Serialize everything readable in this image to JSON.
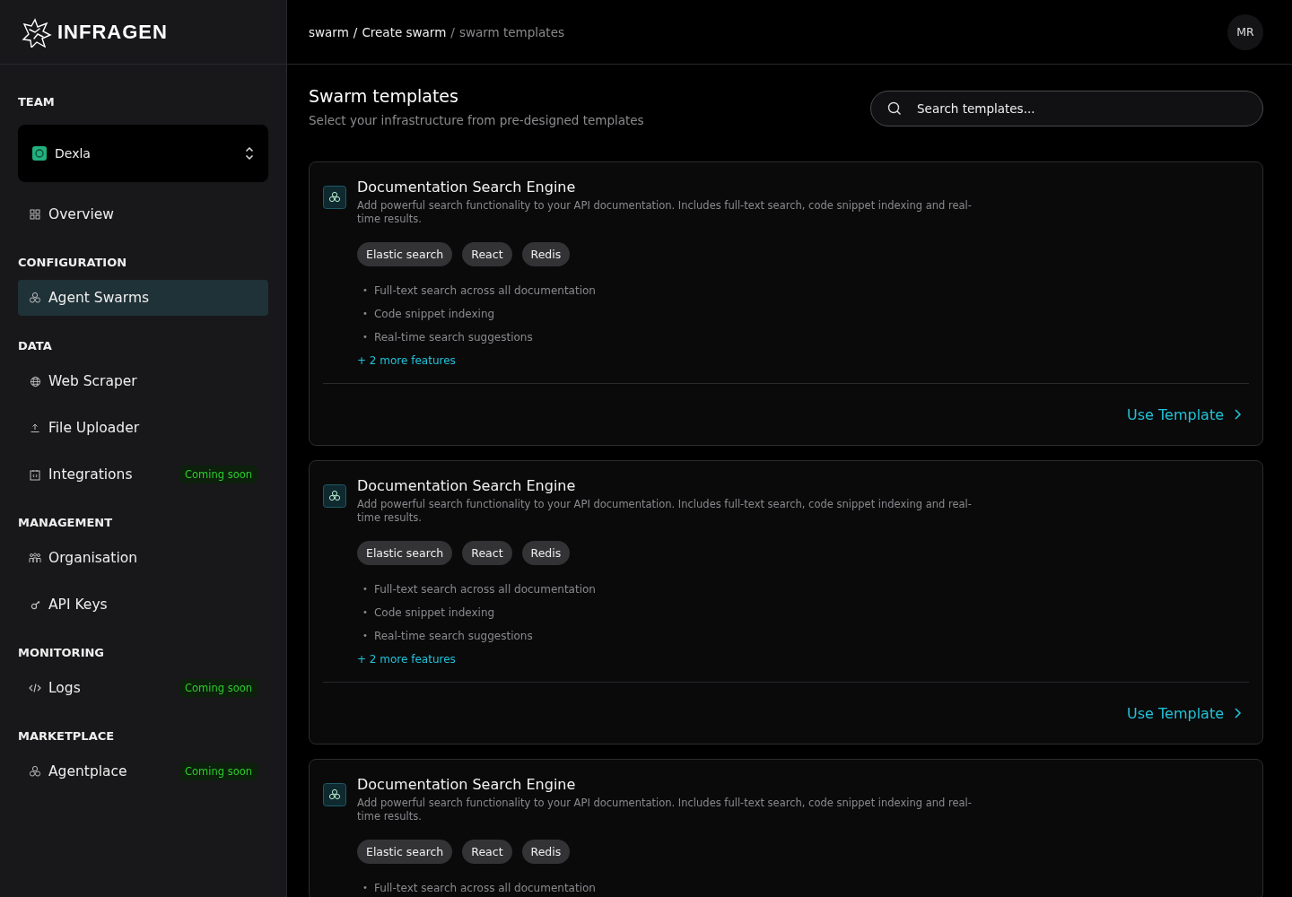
{
  "brand": {
    "name": "INFRAGEN"
  },
  "sidebar": {
    "sections": [
      {
        "label": "TEAM",
        "team_selector": {
          "name": "Dexla"
        },
        "items": [
          {
            "label": "Overview",
            "selected": false
          }
        ]
      },
      {
        "label": "CONFIGURATION",
        "items": [
          {
            "label": "Agent Swarms",
            "selected": true
          }
        ]
      },
      {
        "label": "DATA",
        "items": [
          {
            "label": "Web Scraper",
            "selected": false
          },
          {
            "label": "File Uploader",
            "selected": false
          },
          {
            "label": "Integrations",
            "selected": false,
            "badge": "Coming soon"
          }
        ]
      },
      {
        "label": "MANAGEMENT",
        "items": [
          {
            "label": "Organisation",
            "selected": false
          },
          {
            "label": "API Keys",
            "selected": false
          }
        ]
      },
      {
        "label": "MONITORING",
        "items": [
          {
            "label": "Logs",
            "selected": false,
            "badge": "Coming soon"
          }
        ]
      },
      {
        "label": "MARKETPLACE",
        "items": [
          {
            "label": "Agentplace",
            "selected": false,
            "badge": "Coming soon"
          }
        ]
      }
    ]
  },
  "breadcrumb": [
    {
      "label": "swarm",
      "current": false
    },
    {
      "separator": "/",
      "label": "Create swarm",
      "current": false
    },
    {
      "separator": "/",
      "label": "swarm templates",
      "current": true
    }
  ],
  "avatar": {
    "initials": "MR"
  },
  "page": {
    "title": "Swarm templates",
    "subtitle": "Select your infrastructure from pre-designed templates"
  },
  "search": {
    "placeholder": "Search templates..."
  },
  "templates": [
    {
      "title": "Documentation Search Engine",
      "description": "Add powerful search functionality to your API documentation. Includes full-text search, code snippet indexing and real-time results.",
      "tags": [
        "Elastic search",
        "React",
        "Redis"
      ],
      "features": [
        {
          "marker": "•",
          "text": "Full-text search across all documentation"
        },
        {
          "marker": "•",
          "text": "Code snippet indexing"
        },
        {
          "marker": "•",
          "text": "Real-time search suggestions"
        }
      ],
      "more": "+ 2 more features",
      "action": "Use Template"
    },
    {
      "title": "Documentation Search Engine",
      "description": "Add powerful search functionality to your API documentation. Includes full-text search, code snippet indexing and real-time results.",
      "tags": [
        "Elastic search",
        "React",
        "Redis"
      ],
      "features": [
        {
          "marker": "•",
          "text": "Full-text search across all documentation"
        },
        {
          "marker": "•",
          "text": "Code snippet indexing"
        },
        {
          "marker": "•",
          "text": "Real-time search suggestions"
        }
      ],
      "more": "+ 2 more features",
      "action": "Use Template"
    },
    {
      "title": "Documentation Search Engine",
      "description": "Add powerful search functionality to your API documentation. Includes full-text search, code snippet indexing and real-time results.",
      "tags": [
        "Elastic search",
        "React",
        "Redis"
      ],
      "features": [
        {
          "marker": "•",
          "text": "Full-text search across all documentation"
        }
      ]
    }
  ]
}
